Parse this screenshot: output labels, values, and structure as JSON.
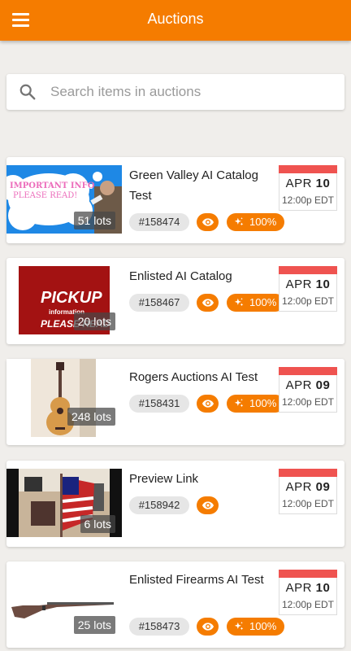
{
  "app": {
    "title": "Auctions"
  },
  "search": {
    "placeholder": "Search items in auctions"
  },
  "colors": {
    "primary": "#f57c00",
    "calendar_bar": "#ef5350"
  },
  "auctions": [
    {
      "title": "Green Valley AI Catalog Test",
      "id": "#158474",
      "lots": "51 lots",
      "month": "APR",
      "day": "10",
      "time": "12:00p EDT",
      "ai": "100%",
      "image": {
        "line1": "IMPORTANT INFO",
        "line2": "PLEASE READ!"
      }
    },
    {
      "title": "Enlisted AI Catalog",
      "id": "#158467",
      "lots": "20 lots",
      "month": "APR",
      "day": "10",
      "time": "12:00p EDT",
      "ai": "100%",
      "image": {
        "line1": "PICKUP",
        "line2": "information",
        "line3": "PLEASE READ"
      }
    },
    {
      "title": "Rogers Auctions AI Test",
      "id": "#158431",
      "lots": "248 lots",
      "month": "APR",
      "day": "09",
      "time": "12:00p EDT",
      "ai": "100%"
    },
    {
      "title": "Preview Link",
      "id": "#158942",
      "lots": "6 lots",
      "month": "APR",
      "day": "09",
      "time": "12:00p EDT"
    },
    {
      "title": "Enlisted Firearms AI Test",
      "id": "#158473",
      "lots": "25 lots",
      "month": "APR",
      "day": "10",
      "time": "12:00p EDT",
      "ai": "100%"
    }
  ]
}
